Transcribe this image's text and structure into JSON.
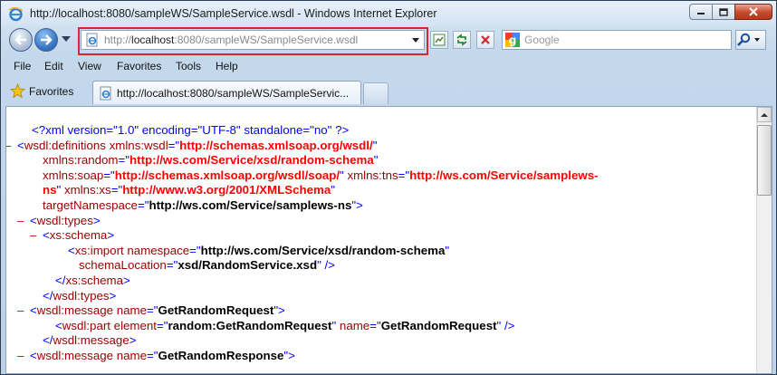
{
  "window": {
    "title": "http://localhost:8080/sampleWS/SampleService.wsdl - Windows Internet Explorer"
  },
  "address": {
    "prefix": "http://",
    "host": "localhost",
    "rest": ":8080/sampleWS/SampleService.wsdl"
  },
  "search": {
    "placeholder": "Google"
  },
  "menu": [
    "File",
    "Edit",
    "View",
    "Favorites",
    "Tools",
    "Help"
  ],
  "favorites": {
    "label": "Favorites"
  },
  "tab": {
    "label": "http://localhost:8080/sampleWS/SampleServic..."
  },
  "icons": {
    "back": "back-arrow-icon",
    "forward": "forward-arrow-icon",
    "refresh": "refresh-icon",
    "stop": "stop-icon",
    "search": "search-magnifier-icon",
    "favorites": "star-icon",
    "page": "ie-page-icon"
  },
  "xml_lines": [
    {
      "indent": 28,
      "minus": false,
      "parts": [
        {
          "c": "pi",
          "t": "<?xml version=\"1.0\" encoding=\"UTF-8\" standalone=\"no\" ?>"
        }
      ]
    },
    {
      "indent": 12,
      "minus": true,
      "parts": [
        {
          "c": "br",
          "t": "<"
        },
        {
          "c": "tag",
          "t": "wsdl:definitions"
        },
        {
          "c": "an",
          "t": " xmlns:wsdl"
        },
        {
          "c": "br",
          "t": "=\""
        },
        {
          "c": "ns",
          "t": "http://schemas.xmlsoap.org/wsdl/"
        },
        {
          "c": "br",
          "t": "\""
        }
      ]
    },
    {
      "indent": 40,
      "minus": false,
      "parts": [
        {
          "c": "an",
          "t": "xmlns:random"
        },
        {
          "c": "br",
          "t": "=\""
        },
        {
          "c": "ns",
          "t": "http://ws.com/Service/xsd/random-schema"
        },
        {
          "c": "br",
          "t": "\""
        }
      ]
    },
    {
      "indent": 40,
      "minus": false,
      "parts": [
        {
          "c": "an",
          "t": "xmlns:soap"
        },
        {
          "c": "br",
          "t": "=\""
        },
        {
          "c": "ns",
          "t": "http://schemas.xmlsoap.org/wsdl/soap/"
        },
        {
          "c": "br",
          "t": "\""
        },
        {
          "c": "an",
          "t": " xmlns:tns"
        },
        {
          "c": "br",
          "t": "=\""
        },
        {
          "c": "ns",
          "t": "http://ws.com/Service/samplews-"
        }
      ]
    },
    {
      "indent": 40,
      "minus": false,
      "parts": [
        {
          "c": "ns",
          "t": "ns"
        },
        {
          "c": "br",
          "t": "\""
        },
        {
          "c": "an",
          "t": " xmlns:xs"
        },
        {
          "c": "br",
          "t": "=\""
        },
        {
          "c": "ns",
          "t": "http://www.w3.org/2001/XMLSchema"
        },
        {
          "c": "br",
          "t": "\""
        }
      ]
    },
    {
      "indent": 40,
      "minus": false,
      "parts": [
        {
          "c": "an",
          "t": "targetNamespace"
        },
        {
          "c": "br",
          "t": "=\""
        },
        {
          "c": "av",
          "t": "http://ws.com/Service/samplews-ns"
        },
        {
          "c": "br",
          "t": "\">"
        }
      ]
    },
    {
      "indent": 26,
      "minus": true,
      "parts": [
        {
          "c": "br",
          "t": "<"
        },
        {
          "c": "tag",
          "t": "wsdl:types"
        },
        {
          "c": "br",
          "t": ">"
        }
      ]
    },
    {
      "indent": 40,
      "minus": true,
      "parts": [
        {
          "c": "br",
          "t": "<"
        },
        {
          "c": "tag",
          "t": "xs:schema"
        },
        {
          "c": "br",
          "t": ">"
        }
      ]
    },
    {
      "indent": 68,
      "minus": false,
      "parts": [
        {
          "c": "br",
          "t": "<"
        },
        {
          "c": "tag",
          "t": "xs:import"
        },
        {
          "c": "an",
          "t": " namespace"
        },
        {
          "c": "br",
          "t": "=\""
        },
        {
          "c": "av",
          "t": "http://ws.com/Service/xsd/random-schema"
        },
        {
          "c": "br",
          "t": "\""
        }
      ]
    },
    {
      "indent": 80,
      "minus": false,
      "parts": [
        {
          "c": "an",
          "t": "schemaLocation"
        },
        {
          "c": "br",
          "t": "=\""
        },
        {
          "c": "av",
          "t": "xsd/RandomService.xsd"
        },
        {
          "c": "br",
          "t": "\" />"
        }
      ]
    },
    {
      "indent": 54,
      "minus": false,
      "parts": [
        {
          "c": "br",
          "t": "</"
        },
        {
          "c": "tag",
          "t": "xs:schema"
        },
        {
          "c": "br",
          "t": ">"
        }
      ]
    },
    {
      "indent": 40,
      "minus": false,
      "parts": [
        {
          "c": "br",
          "t": "</"
        },
        {
          "c": "tag",
          "t": "wsdl:types"
        },
        {
          "c": "br",
          "t": ">"
        }
      ]
    },
    {
      "indent": 26,
      "minus": true,
      "parts": [
        {
          "c": "br",
          "t": "<"
        },
        {
          "c": "tag",
          "t": "wsdl:message"
        },
        {
          "c": "an",
          "t": " name"
        },
        {
          "c": "br",
          "t": "=\""
        },
        {
          "c": "av",
          "t": "GetRandomRequest"
        },
        {
          "c": "br",
          "t": "\">"
        }
      ]
    },
    {
      "indent": 54,
      "minus": false,
      "parts": [
        {
          "c": "br",
          "t": "<"
        },
        {
          "c": "tag",
          "t": "wsdl:part"
        },
        {
          "c": "an",
          "t": " element"
        },
        {
          "c": "br",
          "t": "=\""
        },
        {
          "c": "av",
          "t": "random:GetRandomRequest"
        },
        {
          "c": "br",
          "t": "\""
        },
        {
          "c": "an",
          "t": " name"
        },
        {
          "c": "br",
          "t": "=\""
        },
        {
          "c": "av",
          "t": "GetRandomRequest"
        },
        {
          "c": "br",
          "t": "\" />"
        }
      ]
    },
    {
      "indent": 40,
      "minus": false,
      "parts": [
        {
          "c": "br",
          "t": "</"
        },
        {
          "c": "tag",
          "t": "wsdl:message"
        },
        {
          "c": "br",
          "t": ">"
        }
      ]
    },
    {
      "indent": 26,
      "minus": true,
      "parts": [
        {
          "c": "br",
          "t": "<"
        },
        {
          "c": "tag",
          "t": "wsdl:message"
        },
        {
          "c": "an",
          "t": " name"
        },
        {
          "c": "br",
          "t": "=\""
        },
        {
          "c": "av",
          "t": "GetRandomResponse"
        },
        {
          "c": "br",
          "t": "\">"
        }
      ]
    }
  ]
}
